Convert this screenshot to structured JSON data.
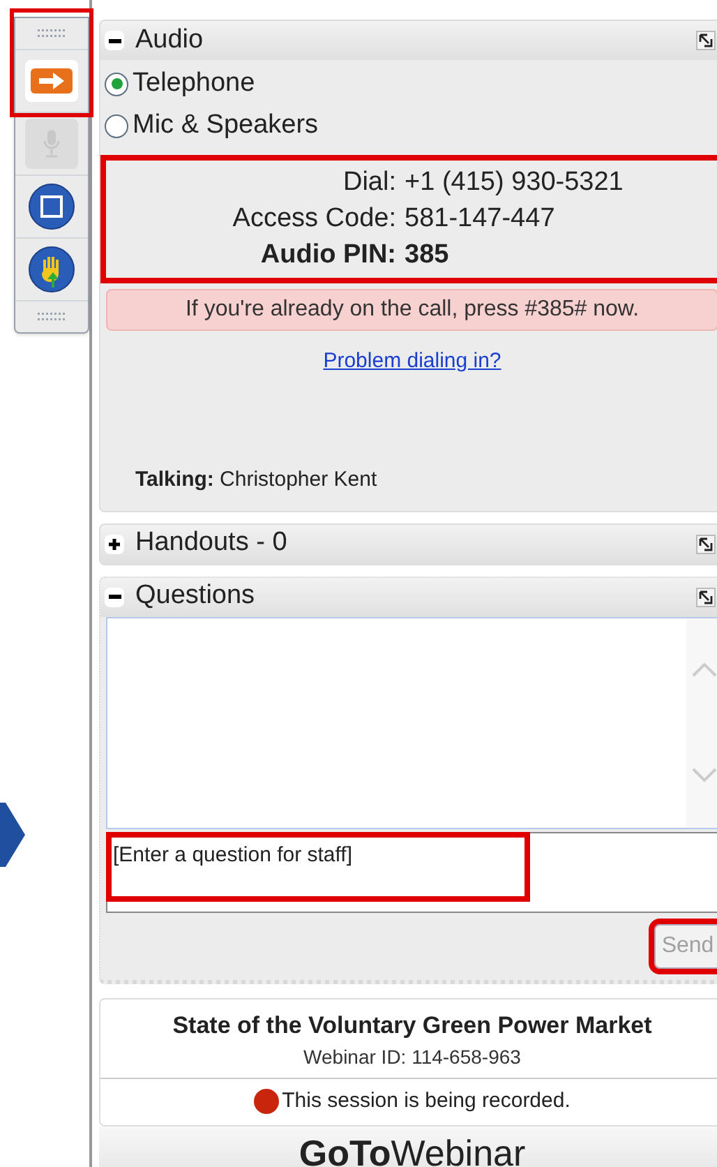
{
  "toolbar": {
    "items": [
      {
        "kind": "grip"
      },
      {
        "kind": "arrow",
        "highlighted": true,
        "disabled": false
      },
      {
        "kind": "mic",
        "highlighted": false,
        "disabled": true
      },
      {
        "kind": "screen",
        "highlighted": false,
        "disabled": false
      },
      {
        "kind": "hand",
        "highlighted": false,
        "disabled": false
      },
      {
        "kind": "grip"
      }
    ]
  },
  "audio": {
    "title": "Audio",
    "expanded": true,
    "options": [
      {
        "label": "Telephone",
        "selected": true
      },
      {
        "label": "Mic & Speakers",
        "selected": false
      }
    ],
    "info": {
      "highlighted": true,
      "rows": [
        {
          "label": "Dial:",
          "value": "+1 (415) 930-5321",
          "bold": false
        },
        {
          "label": "Access Code:",
          "value": "581-147-447",
          "bold": false
        },
        {
          "label": "Audio PIN:",
          "value": "385",
          "bold": true
        }
      ]
    },
    "notice": "If you're already on the call, press #385# now.",
    "link": "Problem dialing in?",
    "talking": "**Talking:** Christopher Kent"
  },
  "handouts": {
    "title": "Handouts - 0",
    "expanded": false
  },
  "questions": {
    "title": "Questions",
    "expanded": true,
    "input": {
      "placeholder": "[Enter a question for staff]",
      "highlighted": true
    },
    "send": {
      "label": "Send",
      "disabled": true,
      "highlighted": true
    }
  },
  "footer": {
    "title": "State of the Voluntary Green Power Market",
    "webinar_id": "Webinar ID: 114-658-963",
    "recording": "This session is being recorded."
  },
  "brand": {
    "bold": "GoTo",
    "light": "Webinar"
  }
}
